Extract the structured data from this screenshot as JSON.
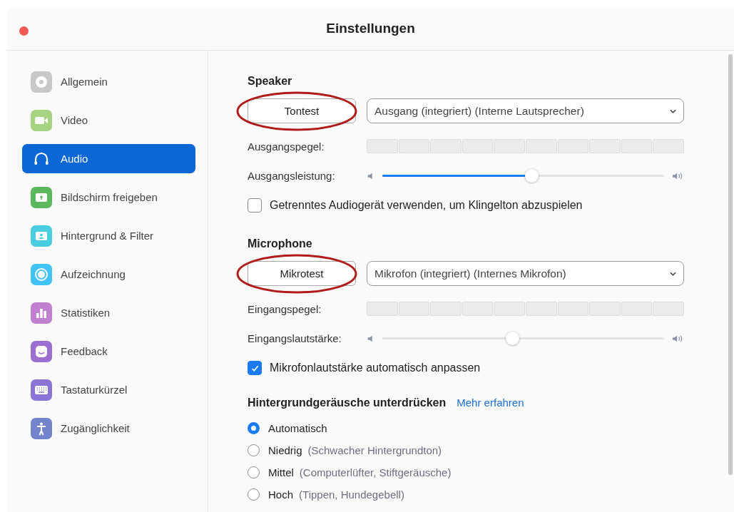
{
  "window": {
    "title": "Einstellungen"
  },
  "sidebar": {
    "items": [
      {
        "label": "Allgemein",
        "kind": "gear",
        "color": "#c8c8c8",
        "selected": false
      },
      {
        "label": "Video",
        "kind": "camera",
        "color": "#a6d37f",
        "selected": false
      },
      {
        "label": "Audio",
        "kind": "headphones",
        "color": "#0b66d6",
        "selected": true
      },
      {
        "label": "Bildschirm freigeben",
        "kind": "share",
        "color": "#5cb85c",
        "selected": false
      },
      {
        "label": "Hintergrund & Filter",
        "kind": "person",
        "color": "#49cde0",
        "selected": false
      },
      {
        "label": "Aufzeichnung",
        "kind": "record",
        "color": "#42c3f5",
        "selected": false
      },
      {
        "label": "Statistiken",
        "kind": "stats",
        "color": "#c17fd0",
        "selected": false
      },
      {
        "label": "Feedback",
        "kind": "smile",
        "color": "#9a6fd0",
        "selected": false
      },
      {
        "label": "Tastaturkürzel",
        "kind": "keyboard",
        "color": "#8a74d6",
        "selected": false
      },
      {
        "label": "Zugänglichkeit",
        "kind": "access",
        "color": "#7285cc",
        "selected": false
      }
    ]
  },
  "speaker": {
    "heading": "Speaker",
    "test_button": {
      "label": "Tontest",
      "circled": true
    },
    "device": "Ausgang (integriert) (Interne Lautsprecher)",
    "meter_label": "Ausgangspegel:",
    "volume_label": "Ausgangsleistung:",
    "volume": {
      "level": 0.53
    },
    "option": {
      "label": "Getrenntes Audiogerät verwenden, um Klingelton abzuspielen",
      "checked": false
    }
  },
  "microphone": {
    "heading": "Microphone",
    "test_button": {
      "label": "Mikrotest",
      "circled": true
    },
    "device": "Mikrofon (integriert) (Internes Mikrofon)",
    "meter_label": "Eingangspegel:",
    "volume_label": "Eingangslautstärke:",
    "volume": {
      "level": 0.46
    },
    "option": {
      "label": "Mikrofonlautstärke automatisch anpassen",
      "checked": true
    }
  },
  "noise": {
    "heading": "Hintergrundgeräusche unterdrücken",
    "link": "Mehr erfahren",
    "options": [
      {
        "label": "Automatisch",
        "selected": true
      },
      {
        "label": "Niedrig",
        "hint": "(Schwacher Hintergrundton)",
        "selected": false
      },
      {
        "label": "Mittel",
        "hint": "(Computerlüfter, Stiftgeräusche)",
        "selected": false
      },
      {
        "label": "Hoch",
        "hint": "(Tippen, Hundegebell)",
        "selected": false
      }
    ]
  }
}
